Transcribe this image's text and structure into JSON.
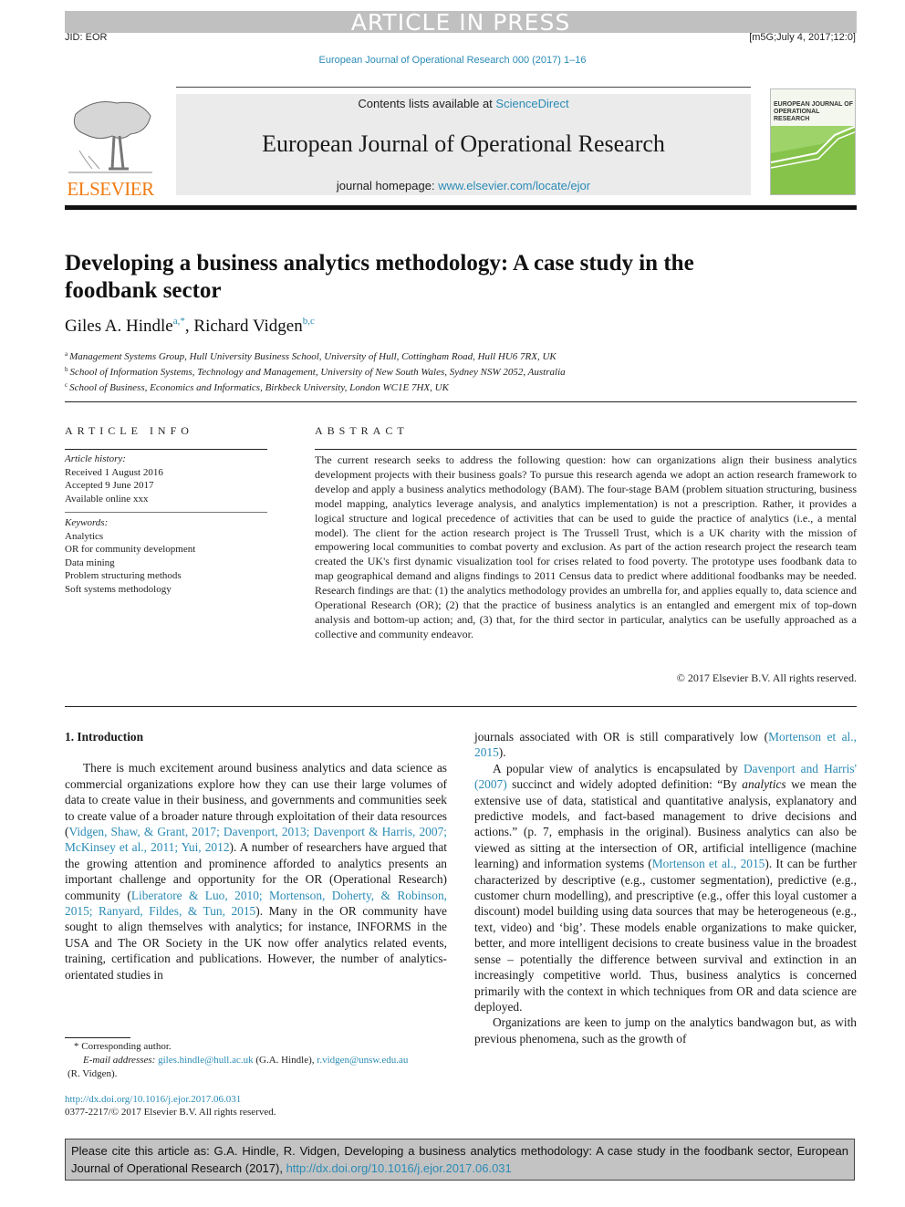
{
  "banner": "ARTICLE IN PRESS",
  "jid": "JID: EOR",
  "stamp": "[m5G;July 4, 2017;12:0]",
  "journal_line": "European Journal of Operational Research 000 (2017) 1–16",
  "masthead": {
    "publisher_logo_text": "ELSEVIER",
    "contents_prefix": "Contents lists available at ",
    "contents_link": "ScienceDirect",
    "journal_title": "European Journal of Operational Research",
    "homepage_prefix": "journal homepage: ",
    "homepage_link": "www.elsevier.com/locate/ejor",
    "cover_title_line1": "EUROPEAN JOURNAL OF",
    "cover_title_line2": "OPERATIONAL RESEARCH"
  },
  "article": {
    "title": "Developing a business analytics methodology: A case study in the foodbank sector",
    "authors": [
      {
        "name": "Giles A. Hindle",
        "marks": "a,*"
      },
      {
        "name": "Richard Vidgen",
        "marks": "b,c"
      }
    ],
    "author_separator": ", ",
    "affiliations": [
      {
        "mark": "a",
        "text": "Management Systems Group, Hull University Business School, University of Hull, Cottingham Road, Hull HU6 7RX, UK"
      },
      {
        "mark": "b",
        "text": "School of Information Systems, Technology and Management, University of New South Wales, Sydney NSW 2052, Australia"
      },
      {
        "mark": "c",
        "text": "School of Business, Economics and Informatics, Birkbeck University, London WC1E 7HX, UK"
      }
    ]
  },
  "article_info": {
    "heading": "ARTICLE INFO",
    "history_label": "Article history:",
    "history": [
      "Received 1 August 2016",
      "Accepted 9 June 2017",
      "Available online xxx"
    ],
    "keywords_label": "Keywords:",
    "keywords": [
      "Analytics",
      "OR for community development",
      "Data mining",
      "Problem structuring methods",
      "Soft systems methodology"
    ]
  },
  "abstract": {
    "heading": "ABSTRACT",
    "text": "The current research seeks to address the following question: how can organizations align their business analytics development projects with their business goals? To pursue this research agenda we adopt an action research framework to develop and apply a business analytics methodology (BAM). The four-stage BAM (problem situation structuring, business model mapping, analytics leverage analysis, and analytics implementation) is not a prescription. Rather, it provides a logical structure and logical precedence of activities that can be used to guide the practice of analytics (i.e., a mental model). The client for the action research project is The Trussell Trust, which is a UK charity with the mission of empowering local communities to combat poverty and exclusion. As part of the action research project the research team created the UK's first dynamic visualization tool for crises related to food poverty. The prototype uses foodbank data to map geographical demand and aligns findings to 2011 Census data to predict where additional foodbanks may be needed. Research findings are that: (1) the analytics methodology provides an umbrella for, and applies equally to, data science and Operational Research (OR); (2) that the practice of business analytics is an entangled and emergent mix of top-down analysis and bottom-up action; and, (3) that, for the third sector in particular, analytics can be usefully approached as a collective and community endeavor.",
    "copyright": "© 2017 Elsevier B.V. All rights reserved."
  },
  "body": {
    "section_title": "1. Introduction",
    "left_p1": [
      {
        "t": "There is much excitement around business analytics and data science as commercial organizations explore how they can use their large volumes of data to create value in their business, and governments and communities seek to create value of a broader nature through exploitation of their data resources ("
      },
      {
        "link": "Vidgen, Shaw, & Grant, 2017; Davenport, 2013; Davenport & Harris, 2007; McKinsey et al., 2011; Yui, 2012"
      },
      {
        "t": "). A number of researchers have argued that the growing attention and prominence afforded to analytics presents an important challenge and opportunity for the OR (Operational Research) community ("
      },
      {
        "link": "Liberatore & Luo, 2010; Mortenson, Doherty, & Robinson, 2015; Ranyard, Fildes, & Tun, 2015"
      },
      {
        "t": "). Many in the OR community have sought to align themselves with analytics; for instance, INFORMS in the USA and The OR Society in the UK now offer analytics related events, training, certification and publications. However, the number of analytics-orientated studies in"
      }
    ],
    "right_p1": [
      {
        "t": "journals associated with OR is still comparatively low ("
      },
      {
        "link": "Mortenson et al., 2015"
      },
      {
        "t": ")."
      }
    ],
    "right_p2": [
      {
        "t": "A popular view of analytics is encapsulated by "
      },
      {
        "link": "Davenport and Harris' (2007)"
      },
      {
        "t": " succinct and widely adopted definition: “By "
      },
      {
        "em": "analytics"
      },
      {
        "t": " we mean the extensive use of data, statistical and quantitative analysis, explanatory and predictive models, and fact-based management to drive decisions and actions.” (p. 7, emphasis in the original). Business analytics can also be viewed as sitting at the intersection of OR, artificial intelligence (machine learning) and information systems ("
      },
      {
        "link": "Mortenson et al., 2015"
      },
      {
        "t": "). It can be further characterized by descriptive (e.g., customer segmentation), predictive (e.g., customer churn modelling), and prescriptive (e.g., offer this loyal customer a discount) model building using data sources that may be heterogeneous (e.g., text, video) and ‘big’. These models enable organizations to make quicker, better, and more intelligent decisions to create business value in the broadest sense – potentially the difference between survival and extinction in an increasingly competitive world. Thus, business analytics is concerned primarily with the context in which techniques from OR and data science are deployed."
      }
    ],
    "right_p3": [
      {
        "t": "Organizations are keen to jump on the analytics bandwagon but, as with previous phenomena, such as the growth of"
      }
    ]
  },
  "footnote": {
    "corresponding": "* Corresponding author.",
    "email_label": "E-mail addresses: ",
    "email1": "giles.hindle@hull.ac.uk",
    "email1_owner": " (G.A. Hindle), ",
    "email2": "r.vidgen@unsw.edu.au",
    "email2_owner": "(R. Vidgen)."
  },
  "doi": {
    "link": "http://dx.doi.org/10.1016/j.ejor.2017.06.031",
    "issn_line": "0377-2217/© 2017 Elsevier B.V. All rights reserved."
  },
  "cite_box": {
    "text": "Please cite this article as: G.A. Hindle, R. Vidgen, Developing a business analytics methodology: A case study in the foodbank sector, European Journal of Operational Research (2017), ",
    "link": "http://dx.doi.org/10.1016/j.ejor.2017.06.031"
  }
}
